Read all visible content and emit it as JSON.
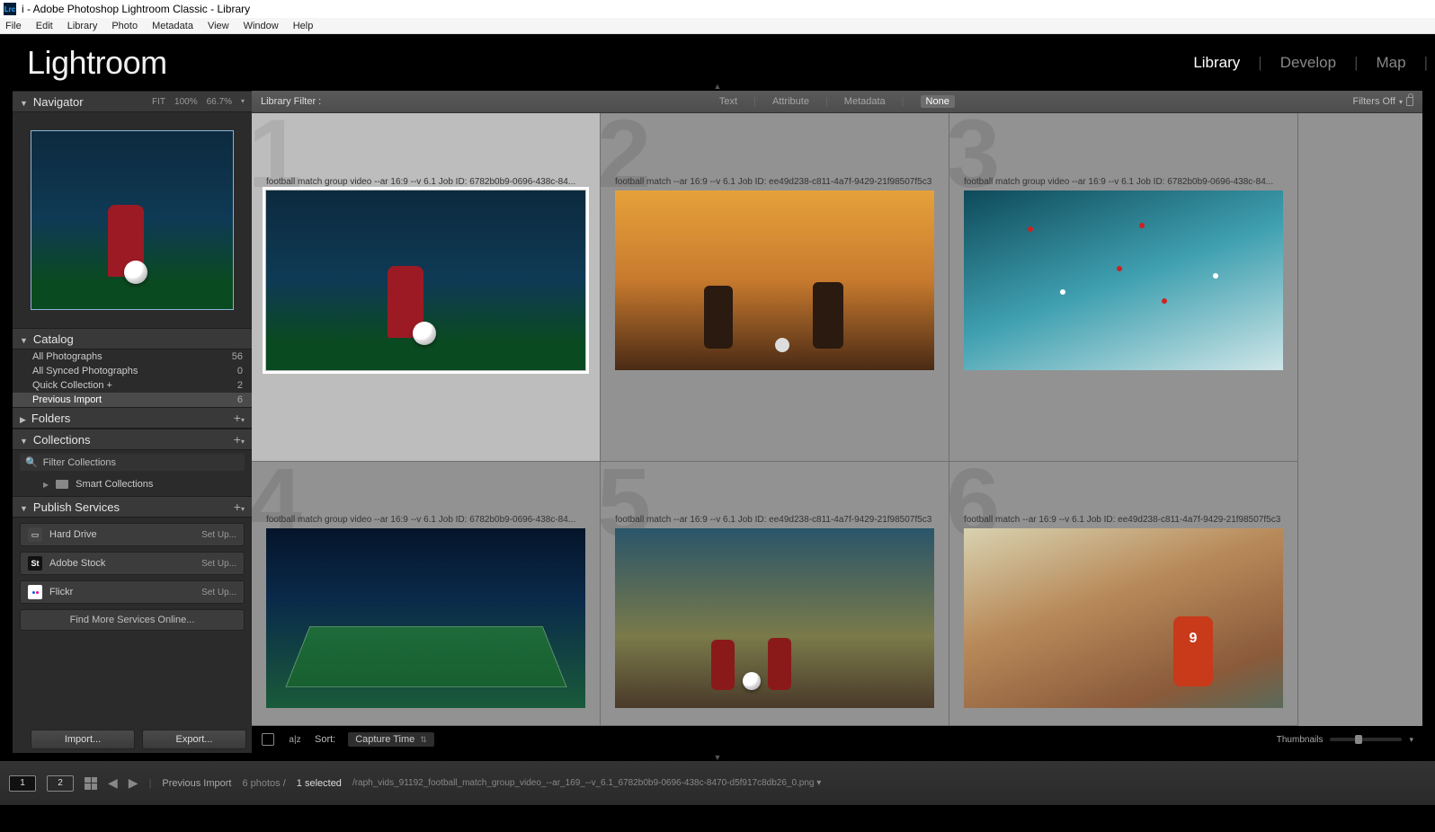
{
  "window": {
    "title": "i - Adobe Photoshop Lightroom Classic - Library",
    "app_icon_text": "Lrc"
  },
  "menu": [
    "File",
    "Edit",
    "Library",
    "Photo",
    "Metadata",
    "View",
    "Window",
    "Help"
  ],
  "module_picker": {
    "logo": "Lightroom",
    "modules": [
      "Library",
      "Develop",
      "Map"
    ],
    "active": "Library"
  },
  "navigator": {
    "title": "Navigator",
    "zoom_levels": [
      "FIT",
      "100%",
      "66.7%"
    ]
  },
  "catalog": {
    "title": "Catalog",
    "items": [
      {
        "label": "All Photographs",
        "count": "56",
        "selected": false
      },
      {
        "label": "All Synced Photographs",
        "count": "0",
        "selected": false
      },
      {
        "label": "Quick Collection  +",
        "count": "2",
        "selected": false
      },
      {
        "label": "Previous Import",
        "count": "6",
        "selected": true
      }
    ]
  },
  "folders": {
    "title": "Folders"
  },
  "collections": {
    "title": "Collections",
    "filter_placeholder": "Filter Collections",
    "smart_label": "Smart Collections"
  },
  "publish": {
    "title": "Publish Services",
    "services": [
      {
        "name": "Hard Drive",
        "action": "Set Up...",
        "icon": "hd"
      },
      {
        "name": "Adobe Stock",
        "action": "Set Up...",
        "icon": "st"
      },
      {
        "name": "Flickr",
        "action": "Set Up...",
        "icon": "fk"
      }
    ],
    "find_more": "Find More Services Online..."
  },
  "buttons": {
    "import": "Import...",
    "export": "Export..."
  },
  "library_filter": {
    "label": "Library Filter :",
    "tabs": [
      "Text",
      "Attribute",
      "Metadata",
      "None"
    ],
    "active": "None",
    "filters_off": "Filters Off"
  },
  "grid": {
    "cells": [
      {
        "num": "1",
        "caption": "football match group video --ar 16:9 --v 6.1 Job ID: 6782b0b9-0696-438c-84...",
        "t": "t1",
        "selected": true
      },
      {
        "num": "2",
        "caption": "football match --ar 16:9 --v 6.1 Job ID: ee49d238-c811-4a7f-9429-21f98507f5c3",
        "t": "t2",
        "selected": false
      },
      {
        "num": "3",
        "caption": "football match group video --ar 16:9 --v 6.1 Job ID: 6782b0b9-0696-438c-84...",
        "t": "t3",
        "selected": false
      },
      {
        "num": "4",
        "caption": "football match group video --ar 16:9 --v 6.1 Job ID: 6782b0b9-0696-438c-84...",
        "t": "t4",
        "selected": false
      },
      {
        "num": "5",
        "caption": "football match --ar 16:9 --v 6.1 Job ID: ee49d238-c811-4a7f-9429-21f98507f5c3",
        "t": "t5",
        "selected": false
      },
      {
        "num": "6",
        "caption": "football match --ar 16:9 --v 6.1 Job ID: ee49d238-c811-4a7f-9429-21f98507f5c3",
        "t": "t6",
        "selected": false
      }
    ]
  },
  "grid_toolbar": {
    "sort_label": "Sort:",
    "sort_value": "Capture Time",
    "thumbnails_label": "Thumbnails",
    "slider_pos": "35%"
  },
  "status": {
    "monitor1": "1",
    "monitor2": "2",
    "breadcrumb": "Previous Import",
    "counts_prefix": "6 photos /",
    "counts_selected": "1 selected",
    "path": "/raph_vids_91192_football_match_group_video_--ar_169_--v_6.1_6782b0b9-0696-438c-8470-d5f917c8db26_0.png ▾"
  }
}
